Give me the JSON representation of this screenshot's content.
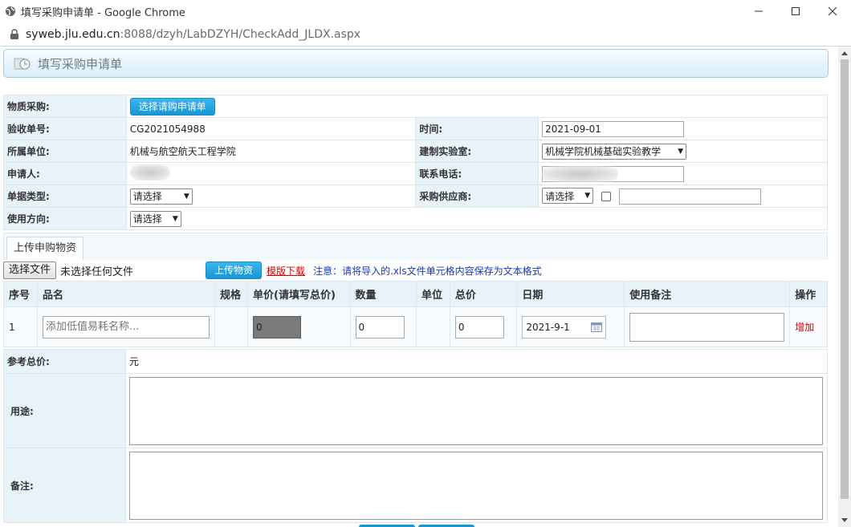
{
  "window": {
    "title": "填写采购申请单 - Google Chrome",
    "url_host": "syweb.jlu.edu.cn",
    "url_rest": ":8088/dzyh/LabDZYH/CheckAdd_JLDX.aspx"
  },
  "header": {
    "title": "填写采购申请单"
  },
  "form": {
    "material_label": "物质采购:",
    "select_request_button": "选择请购申请单",
    "receipt_no_label": "验收单号:",
    "receipt_no": "CG2021054988",
    "time_label": "时间:",
    "time_value": "2021-09-01",
    "unit_label": "所属单位:",
    "unit_value": "机械与航空航天工程学院",
    "lab_label": "建制实验室:",
    "lab_value": "机械学院机械基础实验教学",
    "applicant_label": "申请人:",
    "phone_label": "联系电话:",
    "doc_type_label": "单据类型:",
    "doc_type_value": "请选择",
    "supplier_label": "采购供应商:",
    "supplier_value": "请选择",
    "direction_label": "使用方向:",
    "direction_value": "请选择"
  },
  "upload": {
    "tab_label": "上传申购物资",
    "choose_file": "选择文件",
    "no_file": "未选择任何文件",
    "upload_button": "上传物资",
    "template_link": "模版下载",
    "note": "注意：请将导入的.xls文件单元格内容保存为文本格式"
  },
  "items": {
    "headers": [
      "序号",
      "品名",
      "规格",
      "单价(请填写总价)",
      "数量",
      "单位",
      "总价",
      "日期",
      "使用备注",
      "操作"
    ],
    "row": {
      "index": "1",
      "name_placeholder": "添加低值易耗名称...",
      "price": "0",
      "quantity": "0",
      "total": "0",
      "date": "2021-9-1",
      "action": "增加"
    }
  },
  "summary": {
    "total_label": "参考总价:",
    "currency": "元",
    "purpose_label": "用途:",
    "remark_label": "备注:"
  }
}
